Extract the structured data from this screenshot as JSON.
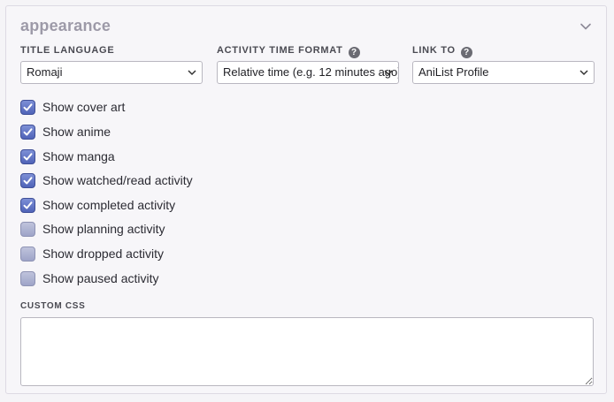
{
  "section": {
    "title": "appearance"
  },
  "fields": {
    "title_language": {
      "label": "TITLE LANGUAGE",
      "value": "Romaji"
    },
    "activity_time_format": {
      "label": "ACTIVITY TIME FORMAT",
      "help": "?",
      "value": "Relative time (e.g. 12 minutes ago)"
    },
    "link_to": {
      "label": "LINK TO",
      "help": "?",
      "value": "AniList Profile"
    }
  },
  "checkboxes": [
    {
      "label": "Show cover art",
      "checked": true
    },
    {
      "label": "Show anime",
      "checked": true
    },
    {
      "label": "Show manga",
      "checked": true
    },
    {
      "label": "Show watched/read activity",
      "checked": true
    },
    {
      "label": "Show completed activity",
      "checked": true
    },
    {
      "label": "Show planning activity",
      "checked": false
    },
    {
      "label": "Show dropped activity",
      "checked": false
    },
    {
      "label": "Show paused activity",
      "checked": false
    }
  ],
  "custom_css": {
    "label": "CUSTOM CSS",
    "value": ""
  },
  "colors": {
    "accent": "#5567bd",
    "panel_bg": "#f7f6f9",
    "title": "#9d9aa8"
  }
}
